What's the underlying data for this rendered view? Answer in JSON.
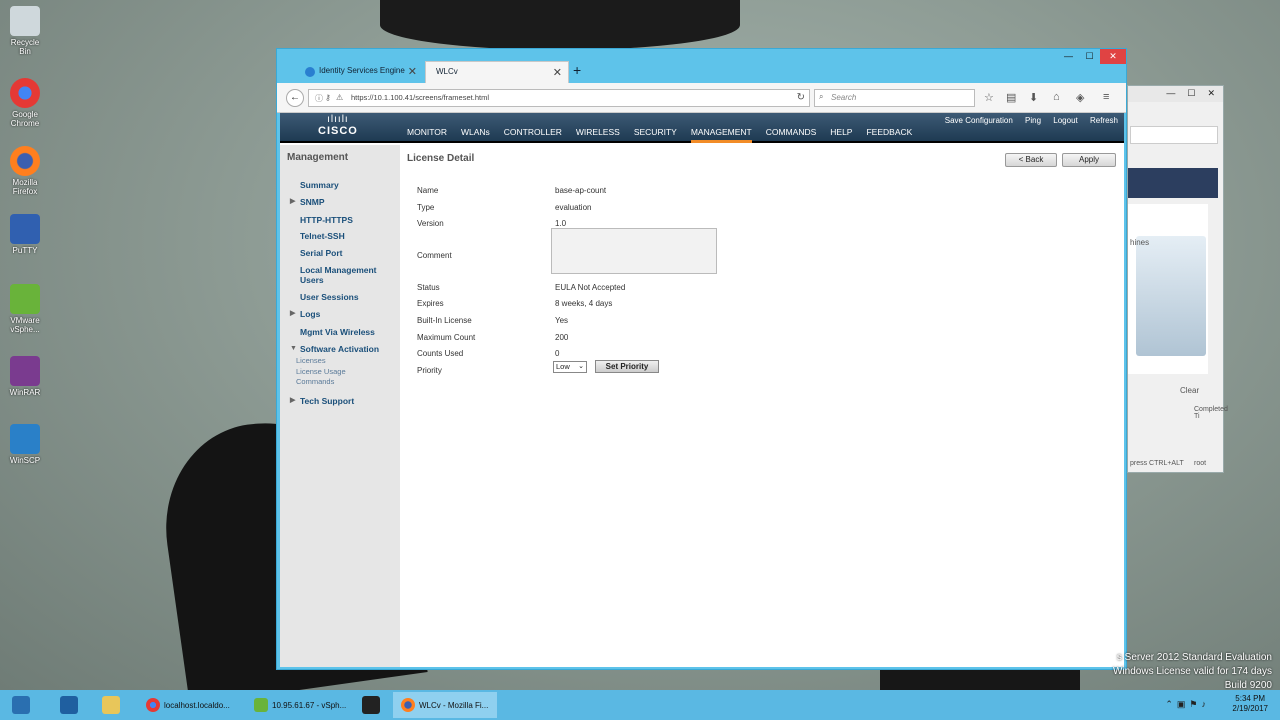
{
  "desktop": {
    "icons": [
      {
        "label": "Recycle Bin",
        "color": "#cfd8dc"
      },
      {
        "label": "Google Chrome",
        "color": "#e53935"
      },
      {
        "label": "Mozilla Firefox",
        "color": "#ff7f1e"
      },
      {
        "label": "PuTTY",
        "color": "#3060b0"
      },
      {
        "label": "VMware vSphe...",
        "color": "#69b33a"
      },
      {
        "label": "WinRAR",
        "color": "#7a3b8f"
      },
      {
        "label": "WinSCP",
        "color": "#2a80c8"
      }
    ],
    "watermark": {
      "line1": "s Server 2012 Standard Evaluation",
      "line2": "Windows License valid for 174 days",
      "line3": "Build 9200"
    }
  },
  "vsphere_window": {
    "text_machines": "hines",
    "clear": "Clear",
    "completed": "Completed Ti",
    "press": "press CTRL+ALT",
    "root": "root"
  },
  "browser": {
    "tabs": [
      {
        "label": "Identity Services Engine"
      },
      {
        "label": "WLCv"
      }
    ],
    "url": "https://10.1.100.41/screens/frameset.html",
    "search_placeholder": "Search"
  },
  "wlc": {
    "logo_word": "CISCO",
    "top_links": [
      "Save Configuration",
      "Ping",
      "Logout",
      "Refresh"
    ],
    "menu": [
      "MONITOR",
      "WLANs",
      "CONTROLLER",
      "WIRELESS",
      "SECURITY",
      "MANAGEMENT",
      "COMMANDS",
      "HELP",
      "FEEDBACK"
    ],
    "sidebar": {
      "title": "Management",
      "items": [
        "Summary",
        "SNMP",
        "HTTP-HTTPS",
        "Telnet-SSH",
        "Serial Port",
        "Local Management Users",
        "User Sessions",
        "Logs",
        "Mgmt Via Wireless",
        "Software Activation",
        "Tech Support"
      ],
      "subitems": [
        "Licenses",
        "License Usage Commands"
      ]
    },
    "license_detail": {
      "title": "License Detail",
      "back_button": "< Back",
      "apply_button": "Apply",
      "fields": [
        {
          "label": "Name",
          "value": "base-ap-count"
        },
        {
          "label": "Type",
          "value": "evaluation"
        },
        {
          "label": "Version",
          "value": "1.0"
        },
        {
          "label": "Comment",
          "value": ""
        },
        {
          "label": "Status",
          "value": "EULA Not Accepted"
        },
        {
          "label": "Expires",
          "value": "8 weeks, 4 days"
        },
        {
          "label": "Built-In License",
          "value": "Yes"
        },
        {
          "label": "Maximum Count",
          "value": "200"
        },
        {
          "label": "Counts Used",
          "value": "0"
        },
        {
          "label": "Priority",
          "value": "Low"
        }
      ],
      "set_priority_button": "Set Priority"
    }
  },
  "taskbar": {
    "buttons": [
      {
        "label": "localhost.localdo..."
      },
      {
        "label": "10.95.61.67 - vSph..."
      },
      {
        "label": "WLCv - Mozilla Fi..."
      }
    ],
    "time": "5:34 PM",
    "date": "2/19/2017"
  }
}
